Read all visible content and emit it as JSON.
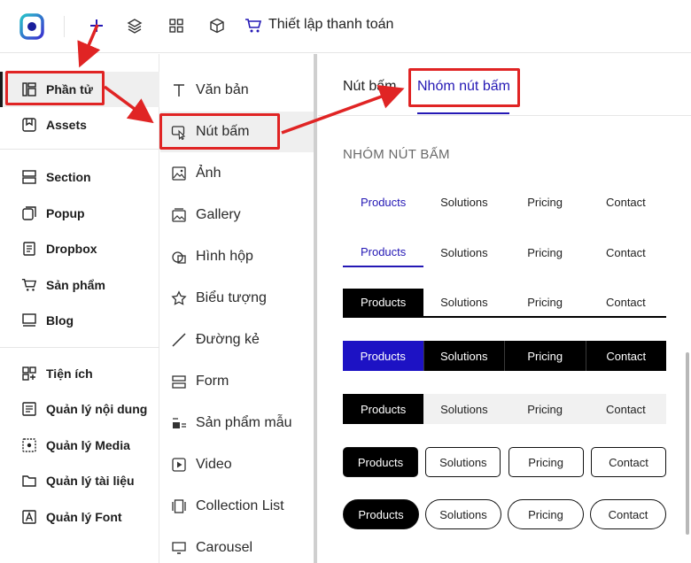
{
  "topbar": {
    "title": "Thiết lập thanh toán",
    "icons": [
      "app-logo",
      "plus-icon",
      "layers-icon",
      "grid-icon",
      "box-icon",
      "cart-icon"
    ]
  },
  "sidebar": {
    "items": [
      {
        "label": "Phần tử",
        "icon": "elements-icon"
      },
      {
        "label": "Assets",
        "icon": "bookmark-icon"
      },
      {
        "label": "Section",
        "icon": "section-icon"
      },
      {
        "label": "Popup",
        "icon": "popup-icon"
      },
      {
        "label": "Dropbox",
        "icon": "dropbox-icon"
      },
      {
        "label": "Sản phẩm",
        "icon": "cart-icon"
      },
      {
        "label": "Blog",
        "icon": "blog-icon"
      },
      {
        "label": "Tiện ích",
        "icon": "utilities-icon"
      },
      {
        "label": "Quản lý nội dung",
        "icon": "content-icon"
      },
      {
        "label": "Quản lý Media",
        "icon": "media-icon"
      },
      {
        "label": "Quản lý tài liệu",
        "icon": "folder-icon"
      },
      {
        "label": "Quản lý Font",
        "icon": "font-icon"
      }
    ]
  },
  "elements": {
    "items": [
      {
        "label": "Văn bản",
        "icon": "text-icon"
      },
      {
        "label": "Nút bấm",
        "icon": "cursor-icon"
      },
      {
        "label": "Ảnh",
        "icon": "image-icon"
      },
      {
        "label": "Gallery",
        "icon": "gallery-icon"
      },
      {
        "label": "Hình hộp",
        "icon": "shapes-icon"
      },
      {
        "label": "Biểu tượng",
        "icon": "star-icon"
      },
      {
        "label": "Đường kẻ",
        "icon": "line-icon"
      },
      {
        "label": "Form",
        "icon": "form-icon"
      },
      {
        "label": "Sản phẩm mẫu",
        "icon": "product-sample-icon"
      },
      {
        "label": "Video",
        "icon": "video-icon"
      },
      {
        "label": "Collection List",
        "icon": "collection-icon"
      },
      {
        "label": "Carousel",
        "icon": "carousel-icon"
      }
    ]
  },
  "panel": {
    "tabs": [
      {
        "label": "Nút bấm"
      },
      {
        "label": "Nhóm nút bấm"
      }
    ],
    "section_title": "NHÓM NÚT BẤM",
    "group_labels": [
      "Products",
      "Solutions",
      "Pricing",
      "Contact"
    ]
  },
  "colors": {
    "accent": "#2418b5",
    "blue_fill": "#1d12c4",
    "annotation": "#e02424"
  }
}
